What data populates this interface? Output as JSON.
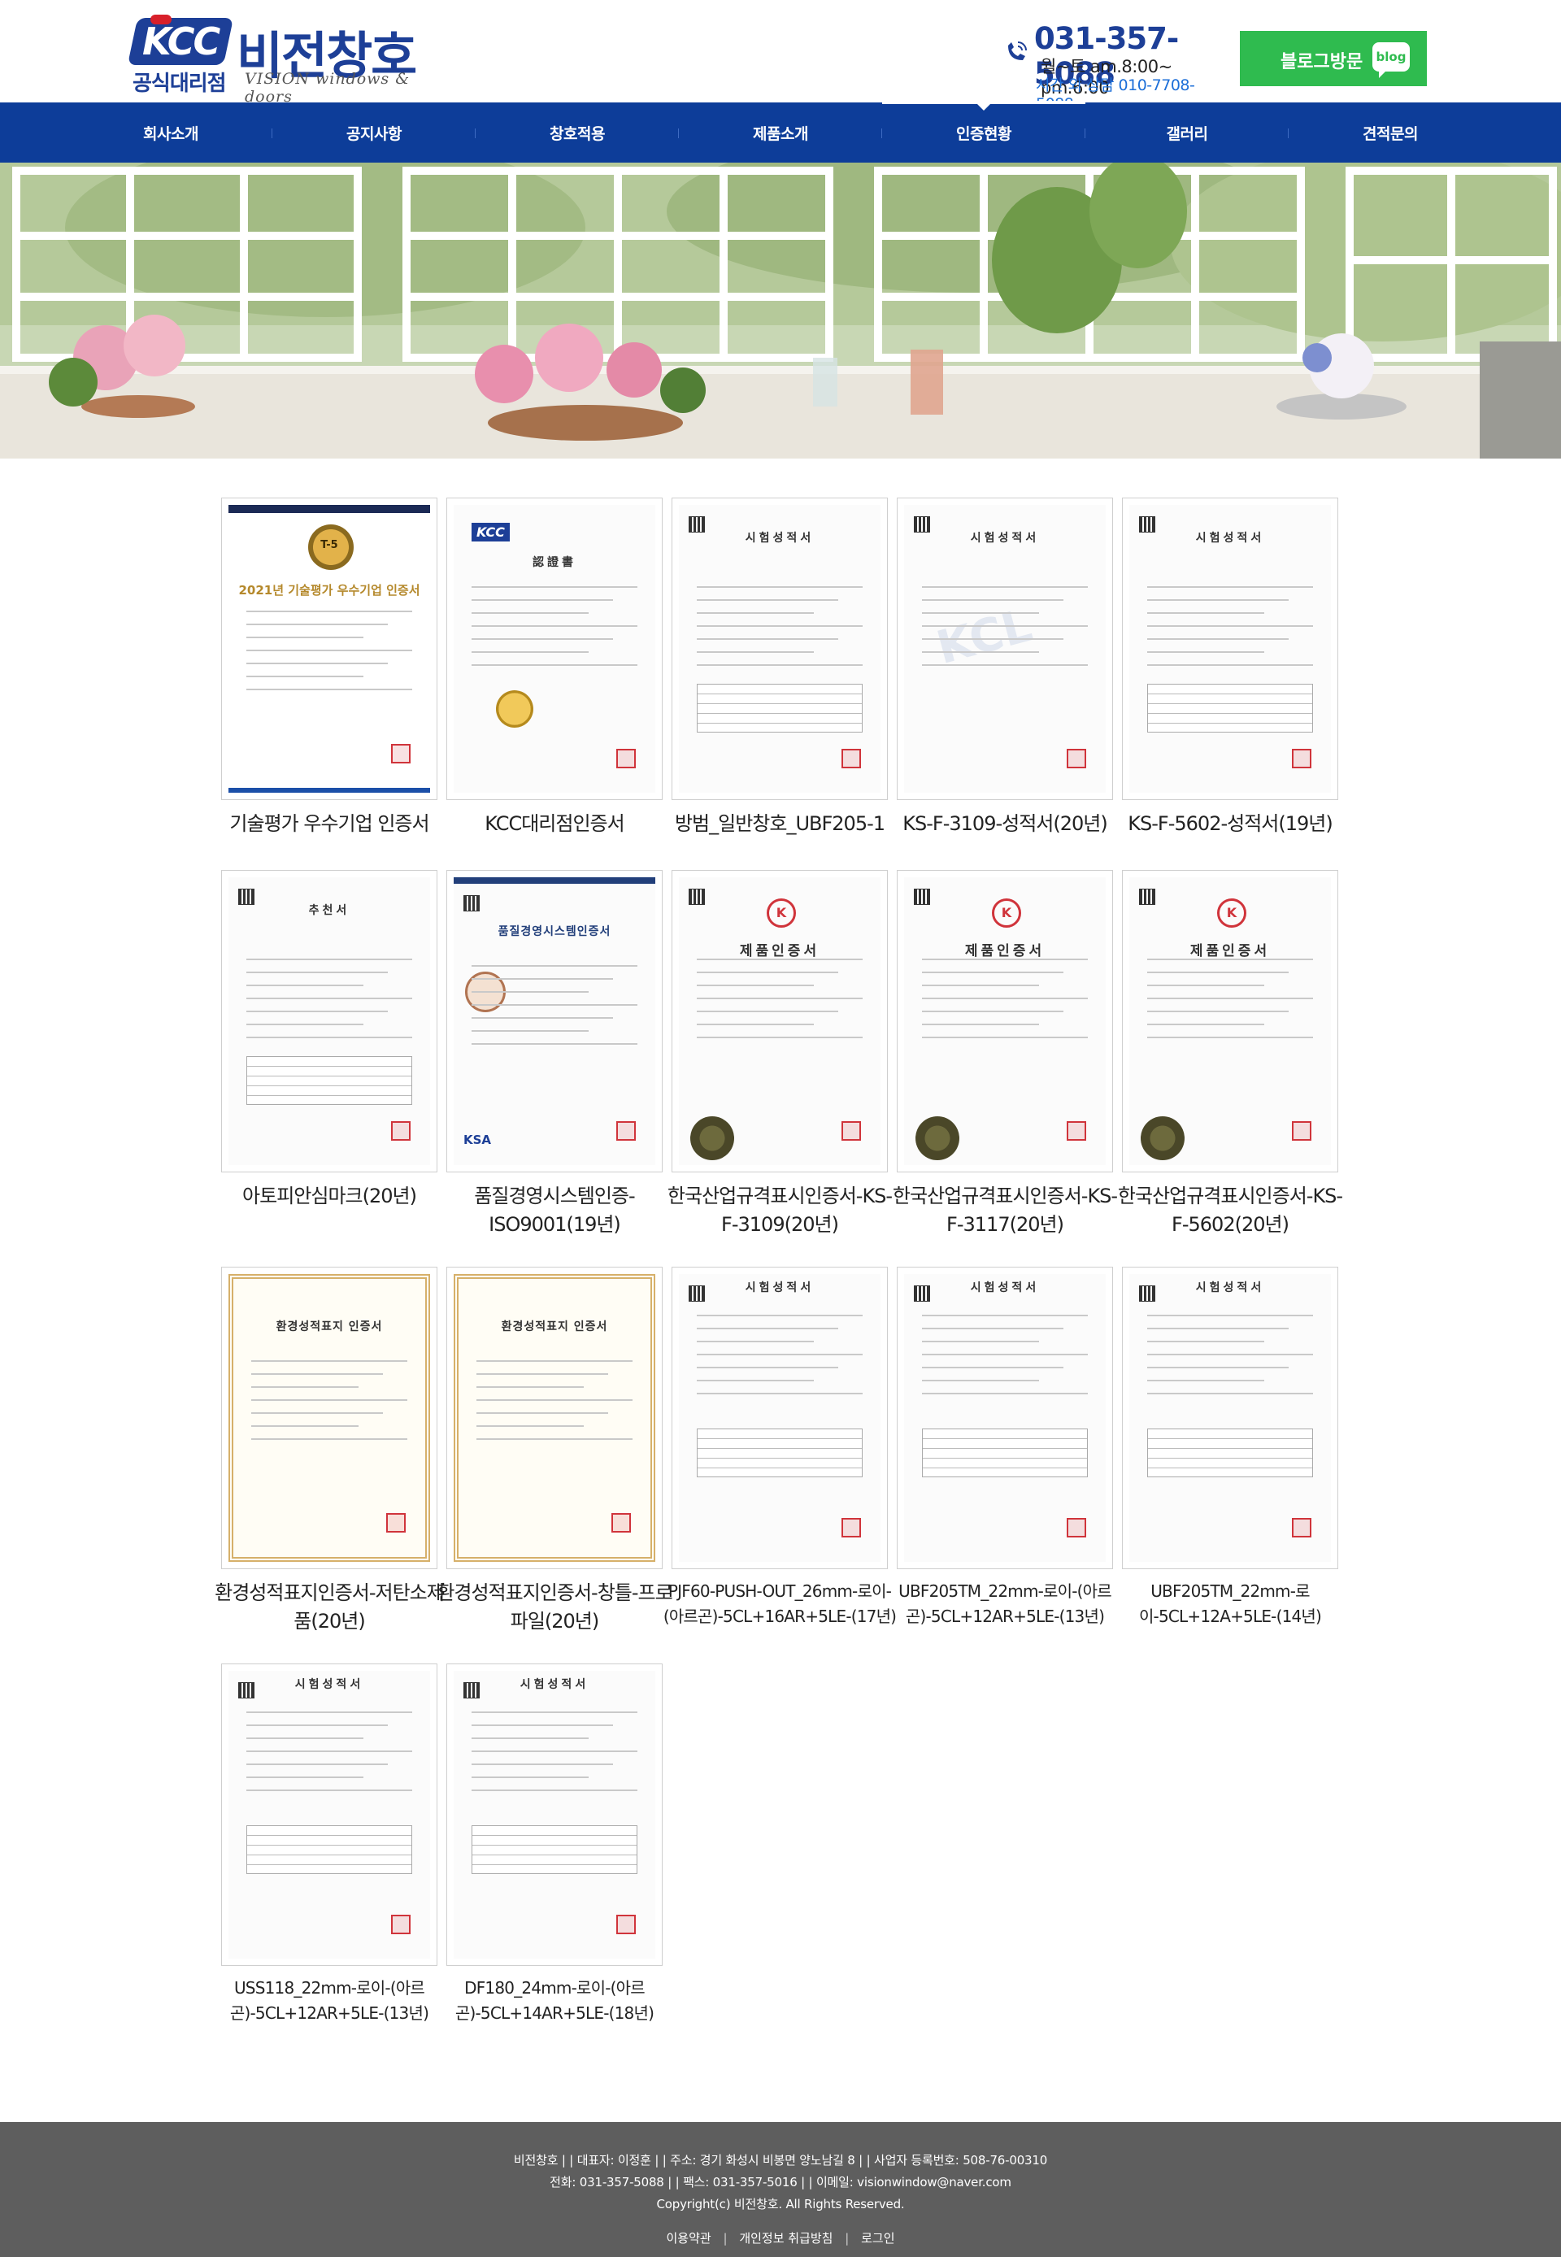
{
  "header": {
    "logo_badge": "KCC",
    "logo_sub": "공식대리점",
    "logo_name": "비전창호",
    "logo_tagline": "VISION windows & doors",
    "phone": "031-357-5088",
    "hours": "월~토 am.8:00~ pm.6:00",
    "after_hours": "시간 외 상담 010-7708-5088",
    "blog_button": "블로그방문",
    "blog_badge": "blog"
  },
  "nav": {
    "items": [
      {
        "label": "회사소개"
      },
      {
        "label": "공지사항"
      },
      {
        "label": "창호적용"
      },
      {
        "label": "제품소개"
      },
      {
        "label": "인증현황"
      },
      {
        "label": "갤러리"
      },
      {
        "label": "견적문의"
      }
    ],
    "active_index": 4
  },
  "gallery": {
    "items": [
      {
        "caption": "기술평가 우수기업 인증서",
        "doc_title": "2021년 기술평가 우수기업 인증서",
        "badge": "T-5"
      },
      {
        "caption": "KCC대리점인증서",
        "doc_title": "認證書",
        "badge": "KCC"
      },
      {
        "caption": "방범_일반창호_UBF205-1",
        "doc_title": "시험성적서"
      },
      {
        "caption": "KS-F-3109-성적서(20년)",
        "doc_title": "시험성적서",
        "badge": "KCL"
      },
      {
        "caption": "KS-F-5602-성적서(19년)",
        "doc_title": "시험성적서"
      },
      {
        "caption": "아토피안심마크(20년)",
        "doc_title": "추천서"
      },
      {
        "caption": "품질경영시스템인증-ISO9001(19년)",
        "doc_title": "품질경영시스템인증서",
        "badge": "KSA"
      },
      {
        "caption": "한국산업규격표시인증서-KS-F-3109(20년)",
        "doc_title": "제품인증서",
        "badge": "K"
      },
      {
        "caption": "한국산업규격표시인증서-KS-F-3117(20년)",
        "doc_title": "제품인증서",
        "badge": "K"
      },
      {
        "caption": "한국산업규격표시인증서-KS-F-5602(20년)",
        "doc_title": "제품인증서",
        "badge": "K"
      },
      {
        "caption": "환경성적표지인증서-저탄소제품(20년)",
        "doc_title": "환경성적표지 인증서"
      },
      {
        "caption": "환경성적표지인증서-창틀-프로파일(20년)",
        "doc_title": "환경성적표지 인증서"
      },
      {
        "caption": "PJF60-PUSH-OUT_26mm-로이-(아르곤)-5CL+16AR+5LE-(17년)",
        "doc_title": "시험성적서"
      },
      {
        "caption": "UBF205TM_22mm-로이-(아르곤)-5CL+12AR+5LE-(13년)",
        "doc_title": "시험성적서"
      },
      {
        "caption": "UBF205TM_22mm-로이-5CL+12A+5LE-(14년)",
        "doc_title": "시험성적서"
      },
      {
        "caption": "USS118_22mm-로이-(아르곤)-5CL+12AR+5LE-(13년)",
        "doc_title": "시험성적서"
      },
      {
        "caption": "DF180_24mm-로이-(아르곤)-5CL+14AR+5LE-(18년)",
        "doc_title": "시험성적서"
      }
    ]
  },
  "footer": {
    "line1": "비전창호 |  |  대표자: 이정훈 |  |  주소: 경기 화성시 비봉면 양노남길 8 |  |  사업자 등록번호: 508-76-00310",
    "line2": "전화: 031-357-5088 |  |  팩스: 031-357-5016 |  |  이메일: visionwindow@naver.com",
    "copyright": "Copyright(c) 비전창호. All Rights Reserved.",
    "links": [
      "이용약관",
      "개인정보 취급방침",
      "로그인"
    ]
  },
  "colors": {
    "brand_blue": "#0d3d99",
    "logo_blue": "#1d3f97",
    "blog_green": "#2fbb4f",
    "footer_gray": "#5e5e5e",
    "accent_red": "#d8202a"
  }
}
